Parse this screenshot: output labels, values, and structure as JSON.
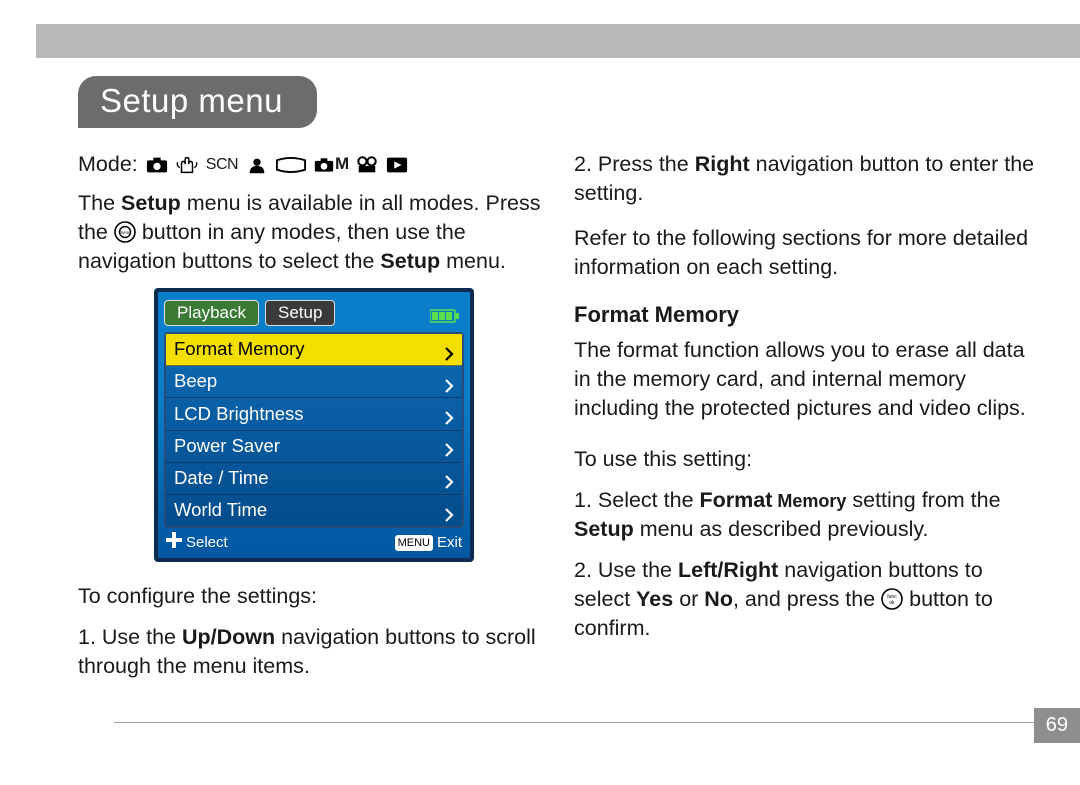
{
  "title": "Setup menu",
  "page_number": "69",
  "left": {
    "mode_label": "Mode:",
    "mode_icons": [
      "camera",
      "hand",
      "scn",
      "portrait",
      "pano",
      "manual",
      "movie",
      "play"
    ],
    "scn_label": "SCN",
    "m_label": "M",
    "intro_pre": "The ",
    "intro_bold1": "Setup",
    "intro_mid1": " menu is available in all modes. Press the ",
    "intro_mid2": " button in any modes, then use the navigation buttons to select the ",
    "intro_bold2": "Setup",
    "intro_end": " menu.",
    "configure_label": "To configure the settings:",
    "step1_pre": "1. Use the ",
    "step1_bold": "Up/Down",
    "step1_post": " navigation buttons to scroll through the menu items.",
    "lcd": {
      "tabs": {
        "inactive": "Playback",
        "active": "Setup"
      },
      "items": [
        "Format Memory",
        "Beep",
        "LCD Brightness",
        "Power Saver",
        "Date / Time",
        "World Time"
      ],
      "selected_index": 0,
      "footer_select": "Select",
      "footer_exit": "Exit",
      "footer_menu": "MENU"
    }
  },
  "right": {
    "step2_pre": "2. Press the ",
    "step2_bold": "Right",
    "step2_post": " navigation button to enter the setting.",
    "refer": "Refer to the following sections for more de­tailed information on each setting.",
    "subhead": "Format Memory",
    "fm_body": "The format function allows you to erase all data in the memory card, and internal memory including the protected pictures and video clips.",
    "to_use": "To use this setting:",
    "fm_step1_pre": "1. Select the ",
    "fm_step1_b1": "Format",
    "fm_step1_b1_small": " Memory",
    "fm_step1_mid": " setting from the ",
    "fm_step1_b2": "Setup",
    "fm_step1_post": " menu as described previously.",
    "fm_step2_pre": "2. Use the ",
    "fm_step2_b1": "Left/Right",
    "fm_step2_mid": " navigation buttons to select ",
    "fm_step2_b2": "Yes",
    "fm_step2_or": " or ",
    "fm_step2_b3": "No",
    "fm_step2_mid2": ", and press the ",
    "fm_step2_post": " button to confirm.",
    "funcok_label": "func ok"
  }
}
